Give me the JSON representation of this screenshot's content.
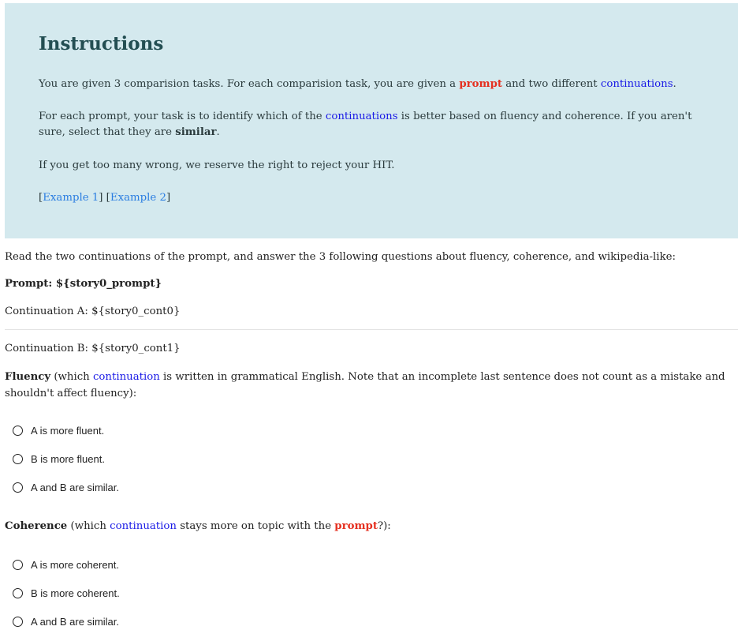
{
  "instructions": {
    "title": "Instructions",
    "p1_a": "You are given 3 comparision tasks. For each comparision task, you are given a ",
    "p1_prompt": "prompt",
    "p1_b": " and two different ",
    "p1_cont": "continuations",
    "p1_c": ".",
    "p2_a": "For each prompt, your task is to identify which of the ",
    "p2_cont": "continuations",
    "p2_b": " is better based on fluency and coherence. If you aren't sure, select that they are ",
    "p2_similar": "similar",
    "p2_c": ".",
    "p3": "If you get too many wrong, we reserve the right to reject your HIT.",
    "example1": "Example 1",
    "example2": "Example 2"
  },
  "intro": "Read the two continuations of the prompt, and answer the 3 following questions about fluency, coherence, and wikipedia-like:",
  "prompt_line": "Prompt: ${story0_prompt}",
  "cont_a": "Continuation A: ${story0_cont0}",
  "cont_b": "Continuation B: ${story0_cont1}",
  "fluency": {
    "label": "Fluency",
    "q_a": " (which ",
    "q_cont": "continuation",
    "q_b": " is written in grammatical English. Note that an incomplete last sentence does not count as a mistake and shouldn't affect fluency):",
    "options": [
      "A is more fluent.",
      "B is more fluent.",
      "A and B are similar."
    ]
  },
  "coherence": {
    "label": "Coherence",
    "q_a": " (which ",
    "q_cont": "continuation",
    "q_b": " stays more on topic with the ",
    "q_prompt": "prompt",
    "q_c": "?):",
    "options": [
      "A is more coherent.",
      "B is more coherent.",
      "A and B are similar."
    ]
  },
  "colors": {
    "panel_bg": "#d4e9ee",
    "title": "#234e52",
    "blue_term": "#1a1ae6",
    "red_term": "#e53020",
    "link": "#2a7de1"
  }
}
